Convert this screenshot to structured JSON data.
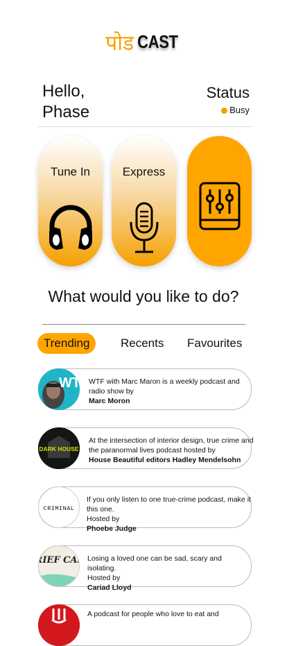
{
  "logo": {
    "hindi": "पोड",
    "english": "CAST"
  },
  "greeting": {
    "line1": "Hello,",
    "line2": "Phase"
  },
  "status": {
    "title": "Status",
    "value": "Busy",
    "color": "#f5a000"
  },
  "cards": [
    {
      "label": "Tune In",
      "icon": "headphones-icon"
    },
    {
      "label": "Express",
      "icon": "microphone-icon"
    },
    {
      "label": "",
      "icon": "equalizer-icon"
    }
  ],
  "question": "What would you like to do?",
  "tabs": [
    {
      "label": "Trending",
      "active": true
    },
    {
      "label": "Recents",
      "active": false
    },
    {
      "label": "Favourites",
      "active": false
    }
  ],
  "podcasts": [
    {
      "desc": "WTF with Marc Maron is a weekly podcast and radio show by",
      "host": "Marc Moron",
      "art_text": "WTF"
    },
    {
      "desc": "At the intersection of interior design, true crime and the paranormal lives podcast hosted by",
      "host": "House Beautiful editors Hadley Mendelsohn",
      "art_text": "DARK HOUSE"
    },
    {
      "desc": "If you only listen to one true-crime podcast, make it this one.",
      "hosted_label": "Hosted by",
      "host": "Phoebe Judge",
      "art_text": "CRIMINAL"
    },
    {
      "desc": "Losing a loved one can be sad, scary and isolating.",
      "hosted_label": "Hosted by",
      "host": "Cariad Lloyd",
      "art_text": "GRIEF CAST"
    },
    {
      "desc": "A podcast for people who love to eat and",
      "host": "",
      "art_text": ""
    }
  ],
  "colors": {
    "accent": "#ffa500",
    "text": "#111111"
  }
}
